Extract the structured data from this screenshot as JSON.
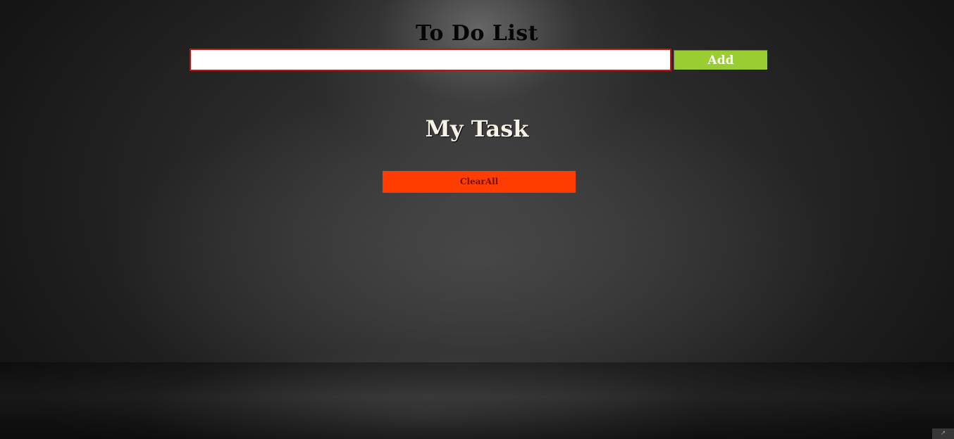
{
  "app": {
    "title": "To Do List"
  },
  "form": {
    "input_value": "",
    "input_placeholder": "",
    "add_label": "Add"
  },
  "tasks": {
    "heading": "My Task",
    "clear_all_label": "ClearAll",
    "items": []
  },
  "colors": {
    "add_button": "#9acd32",
    "clear_button": "#ff3d00",
    "input_border": "#c31313",
    "heading_text": "#f5f3e8",
    "title_text": "#050505"
  },
  "icons": {
    "corner": "arrow-icon"
  }
}
